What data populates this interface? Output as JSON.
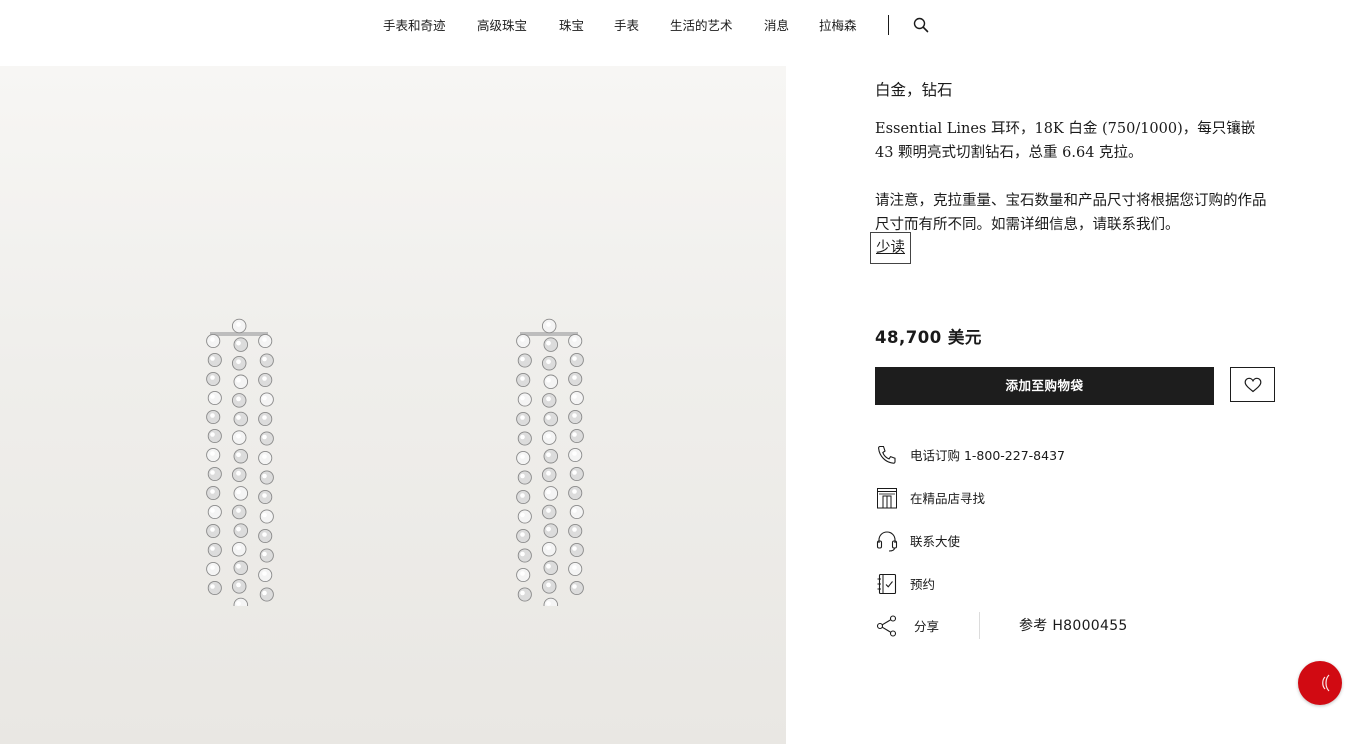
{
  "nav": {
    "items": [
      {
        "label": "手表和奇迹"
      },
      {
        "label": "高级珠宝"
      },
      {
        "label": "珠宝"
      },
      {
        "label": "手表"
      },
      {
        "label": "生活的艺术"
      },
      {
        "label": "消息"
      },
      {
        "label": "拉梅森"
      }
    ],
    "search_icon": "search-icon"
  },
  "product": {
    "subtitle": "白金，钻石",
    "description": "Essential Lines 耳环，18K 白金 (750/1000)，每只镶嵌 43 颗明亮式切割钻石，总重 6.64 克拉。",
    "note": "请注意，克拉重量、宝石数量和产品尺寸将根据您订购的作品尺寸而有所不同。如需详细信息，请联系我们。",
    "read_less": "少读",
    "price": "48,700 美元",
    "add_to_bag": "添加至购物袋",
    "wishlist_icon": "heart-icon"
  },
  "actions": {
    "phone": "电话订购 1-800-227-8437",
    "boutique": "在精品店寻找",
    "ambassador": "联系大使",
    "appointment": "预约",
    "share": "分享",
    "reference": "参考 H8000455"
  },
  "colors": {
    "accent_red": "#d10a12",
    "button_dark": "#1d1d1d"
  }
}
